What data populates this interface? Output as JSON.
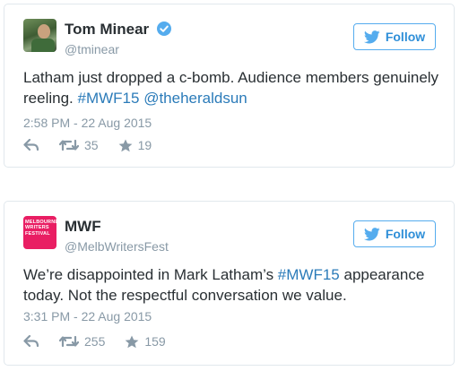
{
  "colors": {
    "link": "#2b7bb9",
    "muted": "#8899a6",
    "follow": "#2f8fd8",
    "border": "#e1e8ed",
    "mwf_pink": "#e91e63"
  },
  "tweets": [
    {
      "display_name": "Tom Minear",
      "verified": true,
      "handle": "@tminear",
      "avatar": "person-photo",
      "follow_label": "Follow",
      "text_plain": "Latham just dropped a c-bomb. Audience members genuinely reeling. ",
      "hashtag": "#MWF15",
      "mention": "@theheraldsun",
      "timestamp": "2:58 PM - 22 Aug 2015",
      "retweets": "35",
      "likes": "19"
    },
    {
      "display_name": "MWF",
      "verified": false,
      "handle": "@MelbWritersFest",
      "avatar": "festival-logo",
      "avatar_logo_lines": [
        "MELBOURNE",
        "WRITERS",
        "FESTIVAL"
      ],
      "follow_label": "Follow",
      "text_before": "We’re disappointed in Mark Latham’s ",
      "hashtag": "#MWF15",
      "text_after": " appearance today. Not the respectful conversation we value.",
      "timestamp": "3:31 PM - 22 Aug 2015",
      "retweets": "255",
      "likes": "159"
    }
  ]
}
